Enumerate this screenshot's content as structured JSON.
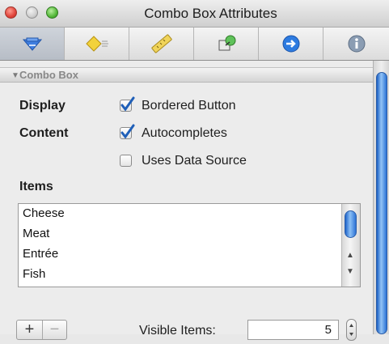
{
  "window": {
    "title": "Combo Box Attributes"
  },
  "toolbar": {
    "tabs": [
      {
        "icon": "attributes-icon",
        "selected": true
      },
      {
        "icon": "effects-icon",
        "selected": false
      },
      {
        "icon": "size-ruler-icon",
        "selected": false
      },
      {
        "icon": "bindings-icon",
        "selected": false
      },
      {
        "icon": "connections-icon",
        "selected": false
      },
      {
        "icon": "identity-info-icon",
        "selected": false
      }
    ]
  },
  "section": {
    "title": "Combo Box"
  },
  "display": {
    "label": "Display",
    "bordered_button": {
      "label": "Bordered Button",
      "checked": true
    }
  },
  "content": {
    "label": "Content",
    "autocompletes": {
      "label": "Autocompletes",
      "checked": true
    },
    "uses_data_source": {
      "label": "Uses Data Source",
      "checked": false
    }
  },
  "items": {
    "label": "Items",
    "list": [
      "Cheese",
      "Meat",
      "Entrée",
      "Fish"
    ]
  },
  "controls": {
    "add_label": "+",
    "remove_label": "−",
    "visible_items_label": "Visible Items:",
    "visible_items_value": "5"
  },
  "colors": {
    "accent": "#2d73d6",
    "check": "#1f5fb8"
  }
}
